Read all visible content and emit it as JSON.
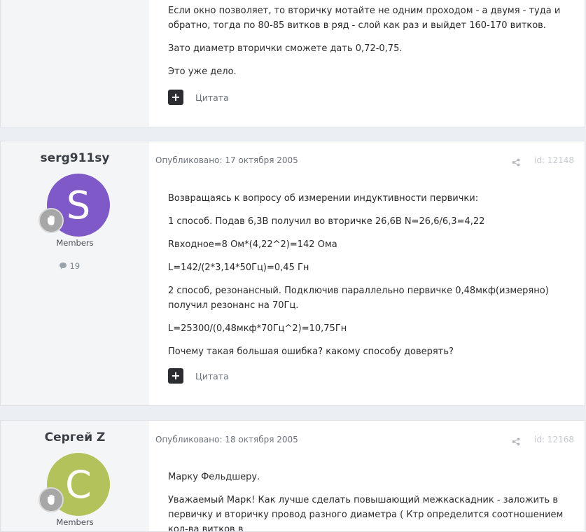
{
  "posts": [
    {
      "content": [
        "Если окно позволяет, то вторичку мотайте не одним проходом - а двумя - туда и обратно, тогда по 80-85 витков в ряд - слой как раз и выйдет 160-170 витков.",
        "Зато диаметр вторички сможете дать 0,72-0,75.",
        "Это уже дело."
      ],
      "quote_label": "Цитата"
    },
    {
      "author": "serg911sy",
      "avatar_letter": "S",
      "avatar_color": "#8059c9",
      "group": "Members",
      "post_count": "19",
      "meta": "Опубликовано: 17 октября 2005",
      "post_id": "id: 12148",
      "content": [
        "Возвращаясь к вопросу об измерении индуктивности первички:",
        "1 способ. Подав 6,3В получил во вторичке 26,6В N=26,6/6,3=4,22",
        "Rвходное=8 Ом*(4,22^2)=142 Ома",
        "L=142/(2*3,14*50Гц)=0,45 Гн",
        "2 способ, резонансный. Подключив параллельно первичке 0,48мкф(измеряно) получил резонанс на 70Гц.",
        "L=25300/(0,48мкф*70Гц^2)=10,75Гн",
        "Почему такая большая ошибка? какому способу доверять?"
      ],
      "quote_label": "Цитата"
    },
    {
      "author": "Сергей Z",
      "avatar_letter": "C",
      "avatar_color": "#b3c25a",
      "group": "Members",
      "meta": "Опубликовано: 18 октября 2005",
      "post_id": "id: 12168",
      "content": [
        "Марку Фельдшеру.",
        "Уважаемый Марк! Как лучше сделать повышающий межкаскадник - заложить в первичку и вторичку провод разного диаметра ( Ктр определится соотношением кол-ва витков в"
      ]
    }
  ],
  "icons": {
    "plus": "+",
    "share": "share-icon",
    "comment": "comment-icon",
    "rank": "hand-badge-icon"
  }
}
